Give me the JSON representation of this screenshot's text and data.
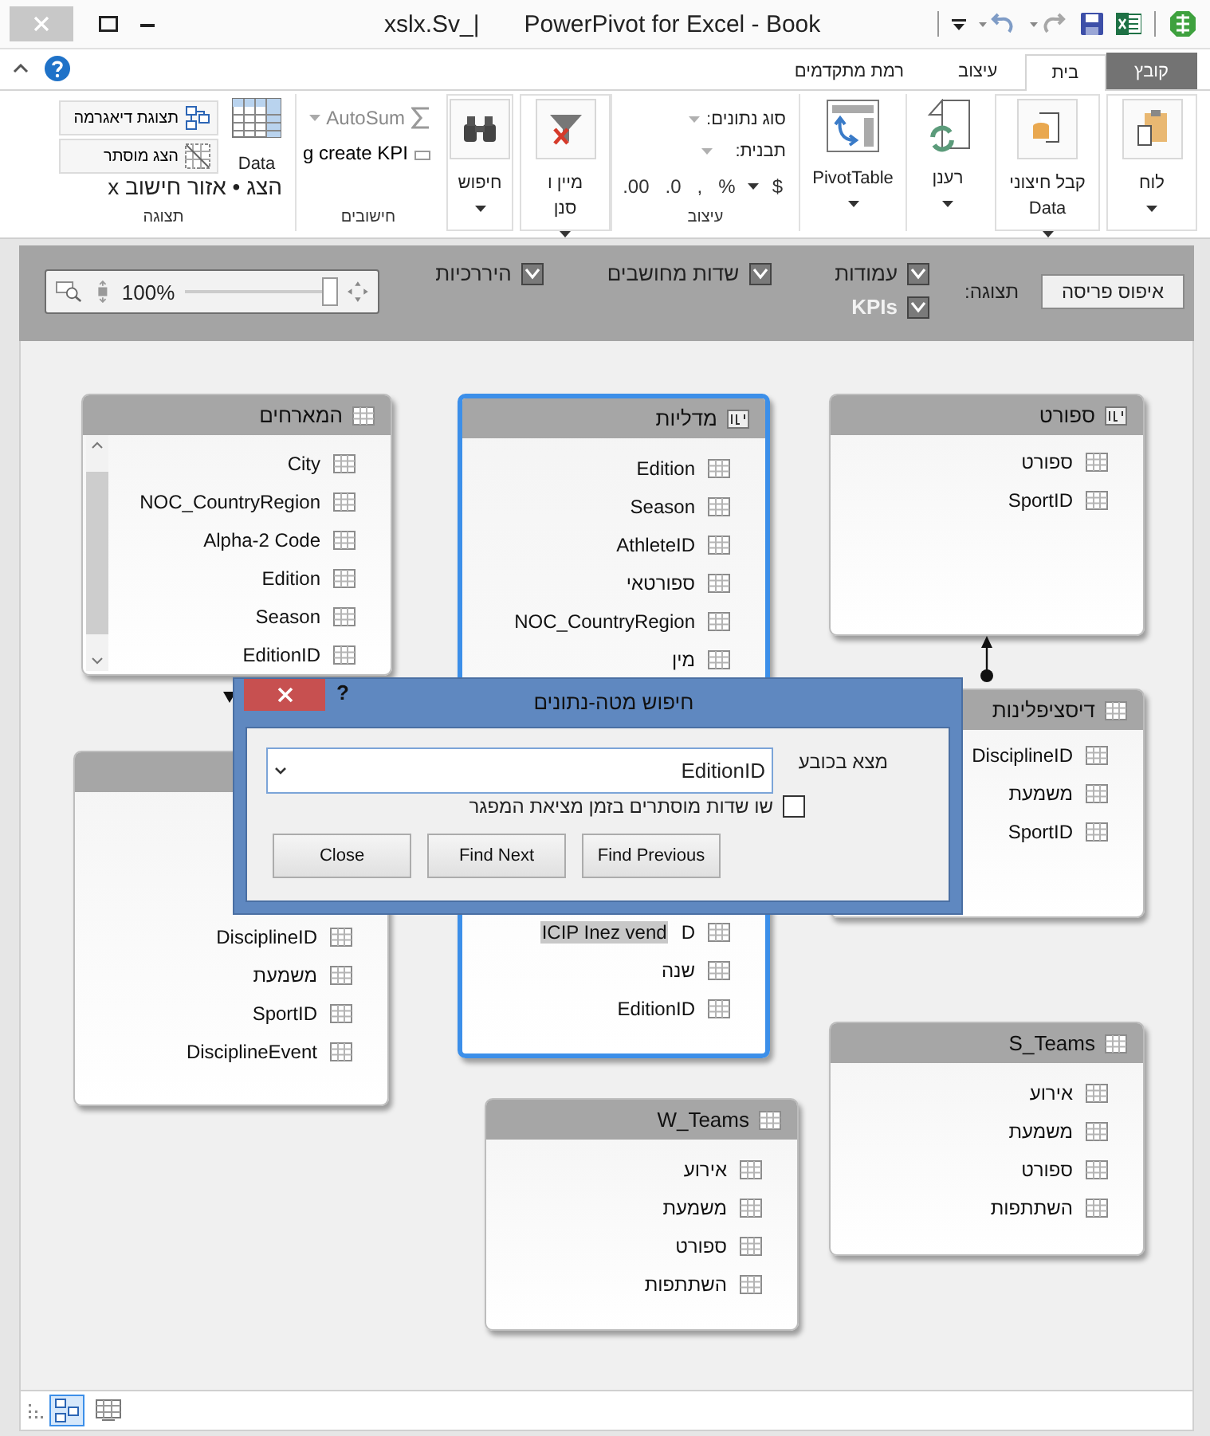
{
  "window": {
    "file_name": "xslx.Sv_|",
    "title": "PowerPivot for Excel - Book"
  },
  "ribbon": {
    "tabs": [
      {
        "label": "קובץ",
        "kind": "file",
        "selected": false
      },
      {
        "label": "בית",
        "kind": "tab",
        "selected": true
      },
      {
        "label": "עיצוב",
        "kind": "tab",
        "selected": false
      },
      {
        "label": "רמת מתקדמים",
        "kind": "tab",
        "selected": false
      }
    ],
    "groups": [
      {
        "kind": "big",
        "lines": [
          "לוח"
        ]
      },
      {
        "kind": "big",
        "lines": [
          "קבל חיצוני",
          "Data"
        ]
      },
      {
        "kind": "big",
        "lines": [
          "רענן"
        ]
      },
      {
        "kind": "big",
        "lines": [
          "PivotTable"
        ]
      },
      {
        "kind": "format",
        "fields": [
          "סוג נתונים:",
          "תבנית:"
        ],
        "symbols": [
          "$",
          "%",
          ",",
          ".0",
          ".00"
        ],
        "caption": "עיצוב"
      },
      {
        "kind": "big",
        "lines": [
          "מיין ו",
          "סנן"
        ]
      },
      {
        "kind": "big",
        "lines": [
          "חיפוש"
        ]
      },
      {
        "kind": "calc",
        "items": [
          {
            "label": "AutoSum",
            "disabled": true
          },
          {
            "label": "g create KPI",
            "disabled": false
          }
        ],
        "caption": "חישובים"
      },
      {
        "kind": "view",
        "buttons": [
          "תצוגת דיאגרמה",
          "הצג מוסתר"
        ],
        "big_label": "Data",
        "toggle_label": "הצג • אזור חישוב x",
        "caption": "תצוגה"
      }
    ]
  },
  "toolbar": {
    "reset_button": "איפוס פריסה",
    "view_label": "תצוגה:",
    "options": [
      {
        "label": "עמודות",
        "checked": true
      },
      {
        "label": "KPIs",
        "checked": true
      },
      {
        "label": "שדות מחושבים",
        "checked": true
      },
      {
        "label": "היררכיות",
        "checked": true
      }
    ],
    "zoom": {
      "reading": "100%",
      "level": 0.92
    }
  },
  "tables": [
    {
      "title": "ספורט",
      "selected": false,
      "items": [
        "ספורט",
        "SportID"
      ]
    },
    {
      "title": "מדליות",
      "selected": true,
      "items": [
        "Edition",
        "Season",
        "AthleteID",
        "ספורטאי",
        "NOC_CountryRegion",
        "מין",
        "D",
        "שנה",
        "EditionID"
      ],
      "highlight": "ICIP Inez vend"
    },
    {
      "title": "המארחים",
      "selected": false,
      "items": [
        "City",
        "NOC_CountryRegion",
        "Alpha-2 Code",
        "Edition",
        "Season",
        "EditionID"
      ]
    },
    {
      "title": "דיסציפלינות",
      "selected": false,
      "items": [
        "DisciplineID",
        "משמעת",
        "SportID"
      ]
    },
    {
      "selected": false,
      "items": [
        "DisciplineID",
        "משמעת",
        "SportID",
        "DisciplineEvent"
      ]
    },
    {
      "title": "S_Teams",
      "selected": false,
      "items": [
        "אירוע",
        "משמעת",
        "ספורט",
        "השתתפות"
      ]
    },
    {
      "title": "W_Teams",
      "selected": false,
      "items": [
        "אירוע",
        "משמעת",
        "ספורט",
        "השתתפות"
      ]
    }
  ],
  "dialog": {
    "title": "חיפוש מטה-נתונים",
    "help": "?",
    "find_label": "מצא בכובע",
    "search": {
      "value": "EditionID"
    },
    "option": {
      "label": "שו שדות מוסתרים בזמן מציאת המפגר",
      "checked": false
    },
    "buttons": [
      "Find Previous",
      "Find Next",
      "Close"
    ]
  },
  "status_bar": {
    "views": [
      {
        "kind": "diagram",
        "selected": true
      },
      {
        "kind": "grid",
        "selected": false
      }
    ]
  }
}
